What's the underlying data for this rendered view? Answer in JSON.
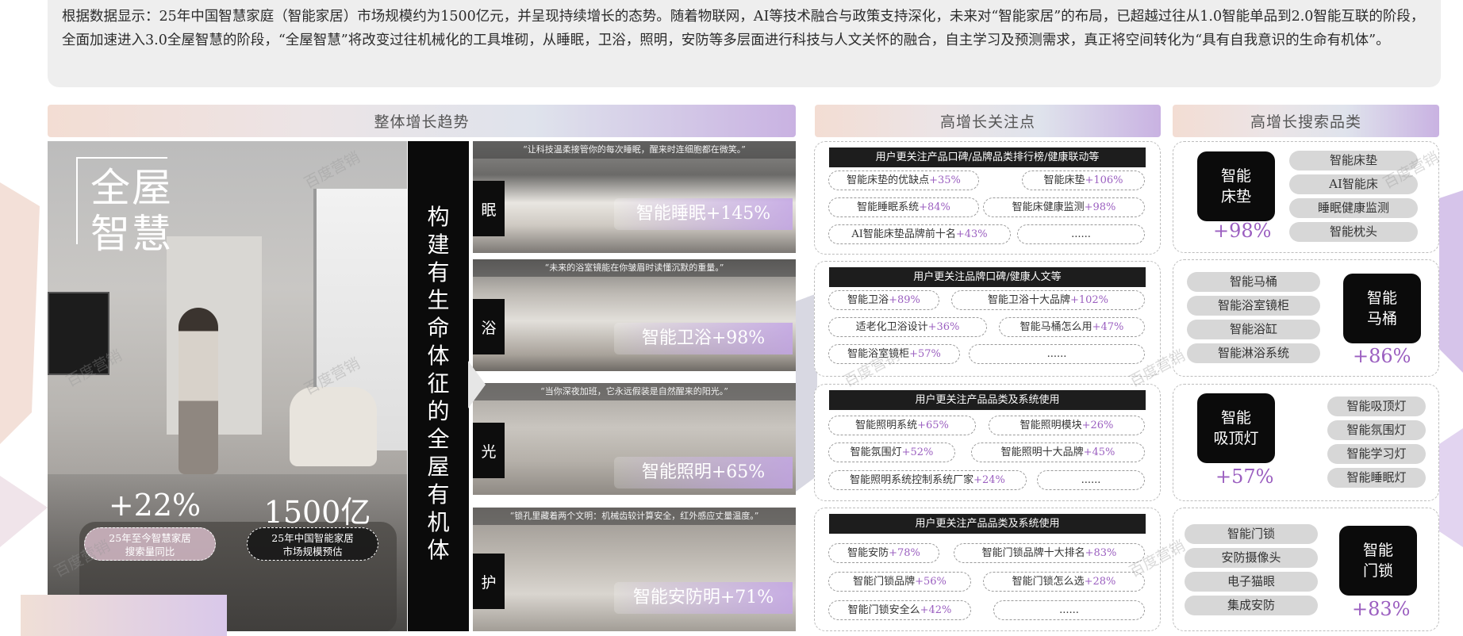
{
  "intro_text": "根据数据显示：25年中国智慧家庭（智能家居）市场规模约为1500亿元，并呈现持续增长的态势。随着物联网，AI等技术融合与政策支持深化，未来对“智能家居”的布局，已超越过往从1.0智能单品到2.0智能互联的阶段，全面加速进入3.0全屋智慧的阶段，“全屋智慧”将改变过往机械化的工具堆砌，从睡眠，卫浴，照明，安防等多层面进行科技与人文关怀的融合，自主学习及预测需求，真正将空间转化为“具有自我意识的生命有机体”。",
  "headers": {
    "trend": "整体增长趋势",
    "focus": "高增长关注点",
    "search": "高增长搜索品类"
  },
  "hero": {
    "title": "全屋\n智慧",
    "stat1_value": "+22%",
    "stat1_label": "25年至今智慧家居\n搜索量同比",
    "stat2_value": "1500亿",
    "stat2_label": "25年中国智能家居\n市场规模预估"
  },
  "vertical_text": "构\n建\n有\n生\n命\n体\n征\n的\n全\n屋\n有\n机\n体",
  "tiles": [
    {
      "quote": "“让科技温柔接管你的每次睡眠，醒来时连细胞都在微笑。”",
      "tag": "眠",
      "label": "智能睡眠+145%"
    },
    {
      "quote": "“未来的浴室镜能在你皱眉时读懂沉默的重量。”",
      "tag": "浴",
      "label": "智能卫浴+98%"
    },
    {
      "quote": "“当你深夜加班，它永远假装是自然醒来的阳光。”",
      "tag": "光",
      "label": "智能照明+65%"
    },
    {
      "quote": "“锁孔里藏着两个文明：机械齿较计算安全，红外感应丈量温度。”",
      "tag": "护",
      "label": "智能安防明+71%"
    }
  ],
  "focus_boxes": [
    {
      "bar": "用户更关注产品口碑/品牌品类排行榜/健康联动等",
      "pills": [
        {
          "text": "智能床垫的优缺点",
          "pct": "+35%"
        },
        {
          "text": "智能床垫",
          "pct": "+106%"
        },
        {
          "text": "智能睡眠系统",
          "pct": "+84%"
        },
        {
          "text": "智能床健康监测",
          "pct": "+98%"
        },
        {
          "text": "AI智能床垫品牌前十名",
          "pct": "+43%"
        },
        {
          "text": "......",
          "pct": ""
        }
      ]
    },
    {
      "bar": "用户更关注品牌口碑/健康人文等",
      "pills": [
        {
          "text": "智能卫浴",
          "pct": "+89%"
        },
        {
          "text": "智能卫浴十大品牌",
          "pct": "+102%"
        },
        {
          "text": "适老化卫浴设计",
          "pct": "+36%"
        },
        {
          "text": "智能马桶怎么用",
          "pct": "+47%"
        },
        {
          "text": "智能浴室镜柜",
          "pct": "+57%"
        },
        {
          "text": "......",
          "pct": ""
        }
      ]
    },
    {
      "bar": "用户更关注产品品类及系统使用",
      "pills": [
        {
          "text": "智能照明系统",
          "pct": "+65%"
        },
        {
          "text": "智能照明模块",
          "pct": "+26%"
        },
        {
          "text": "智能氛围灯",
          "pct": "+52%"
        },
        {
          "text": "智能照明十大品牌",
          "pct": "+45%"
        },
        {
          "text": "智能照明系统控制系统厂家",
          "pct": "+24%"
        },
        {
          "text": "......",
          "pct": ""
        }
      ]
    },
    {
      "bar": "用户更关注产品品类及系统使用",
      "pills": [
        {
          "text": "智能安防",
          "pct": "+78%"
        },
        {
          "text": "智能门锁品牌十大排名",
          "pct": "+83%"
        },
        {
          "text": "智能门锁品牌",
          "pct": "+56%"
        },
        {
          "text": "智能门锁怎么选",
          "pct": "+28%"
        },
        {
          "text": "智能门锁安全么",
          "pct": "+42%"
        },
        {
          "text": "......",
          "pct": ""
        }
      ]
    }
  ],
  "search_boxes": [
    {
      "title": "智能\n床垫",
      "pct": "+98%",
      "items": [
        "智能床垫",
        "AI智能床",
        "睡眠健康监测",
        "智能枕头"
      ]
    },
    {
      "title": "智能\n马桶",
      "pct": "+86%",
      "items": [
        "智能马桶",
        "智能浴室镜柜",
        "智能浴缸",
        "智能淋浴系统"
      ]
    },
    {
      "title": "智能\n吸顶灯",
      "pct": "+57%",
      "items": [
        "智能吸顶灯",
        "智能氛围灯",
        "智能学习灯",
        "智能睡眠灯"
      ]
    },
    {
      "title": "智能\n门锁",
      "pct": "+83%",
      "items": [
        "智能门锁",
        "安防摄像头",
        "电子猫眼",
        "集成安防"
      ]
    }
  ],
  "watermark": "百度营销"
}
